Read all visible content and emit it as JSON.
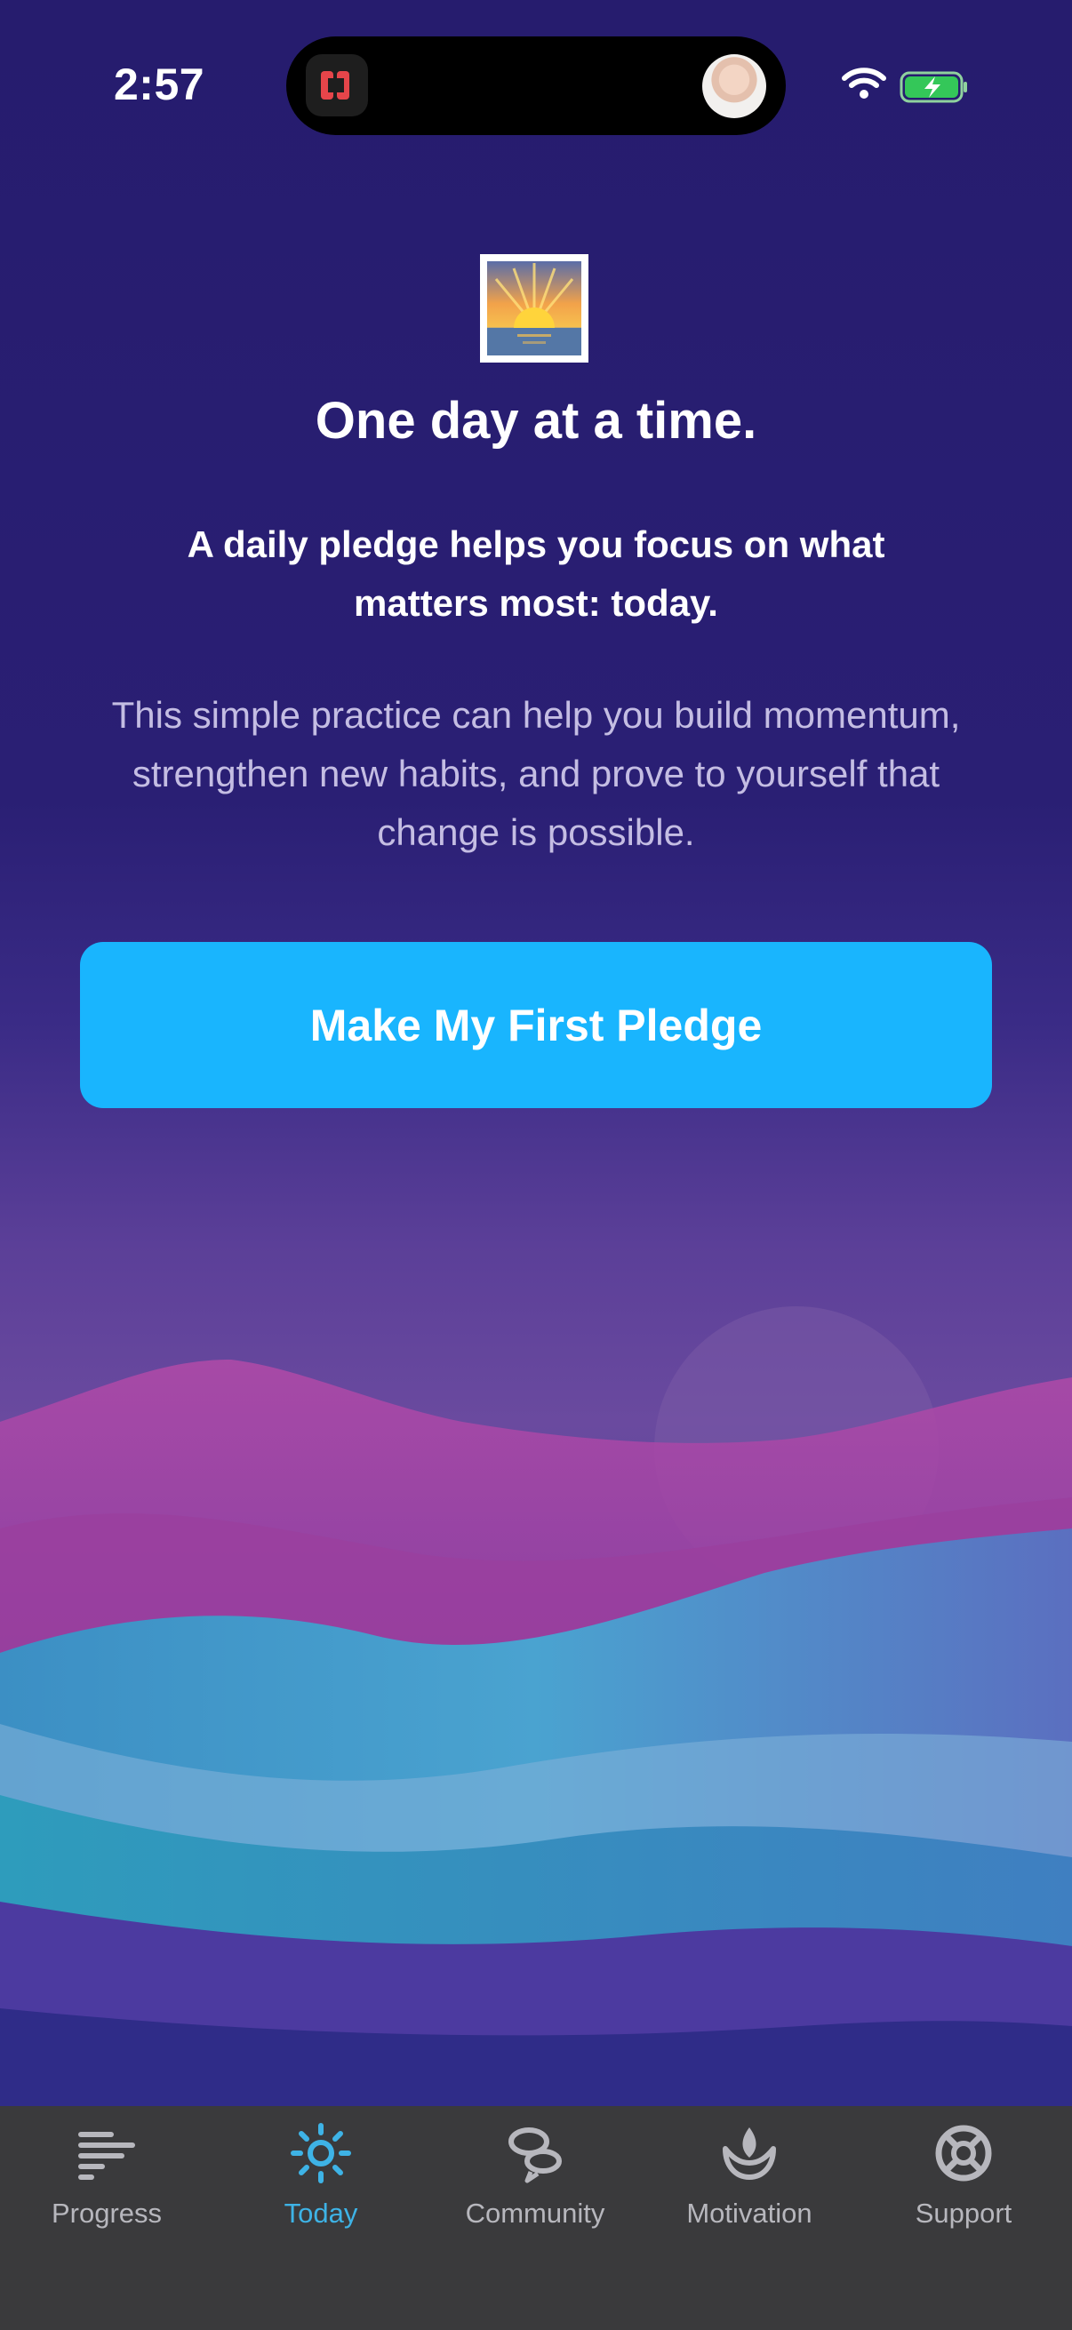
{
  "status_bar": {
    "time": "2:57"
  },
  "content": {
    "title": "One day at a time.",
    "subtitle": "A daily pledge helps you focus on what matters most: today.",
    "body": "This simple practice can help you build momentum, strengthen new habits, and prove to yourself that change is possible.",
    "cta_label": "Make My First Pledge",
    "emoji_icon": "sunrise-icon"
  },
  "tabbar": {
    "items": [
      {
        "label": "Progress",
        "icon": "progress-bars-icon",
        "active": false
      },
      {
        "label": "Today",
        "icon": "sun-icon",
        "active": true
      },
      {
        "label": "Community",
        "icon": "chat-bubbles-icon",
        "active": false
      },
      {
        "label": "Motivation",
        "icon": "lotus-flame-icon",
        "active": false
      },
      {
        "label": "Support",
        "icon": "lifebuoy-icon",
        "active": false
      }
    ]
  },
  "colors": {
    "background_top": "#261c6e",
    "cta": "#19b5fe",
    "tabbar": "#3a3a3c",
    "tab_active": "#3eb3e6",
    "tab_inactive": "#b7b7bd"
  }
}
